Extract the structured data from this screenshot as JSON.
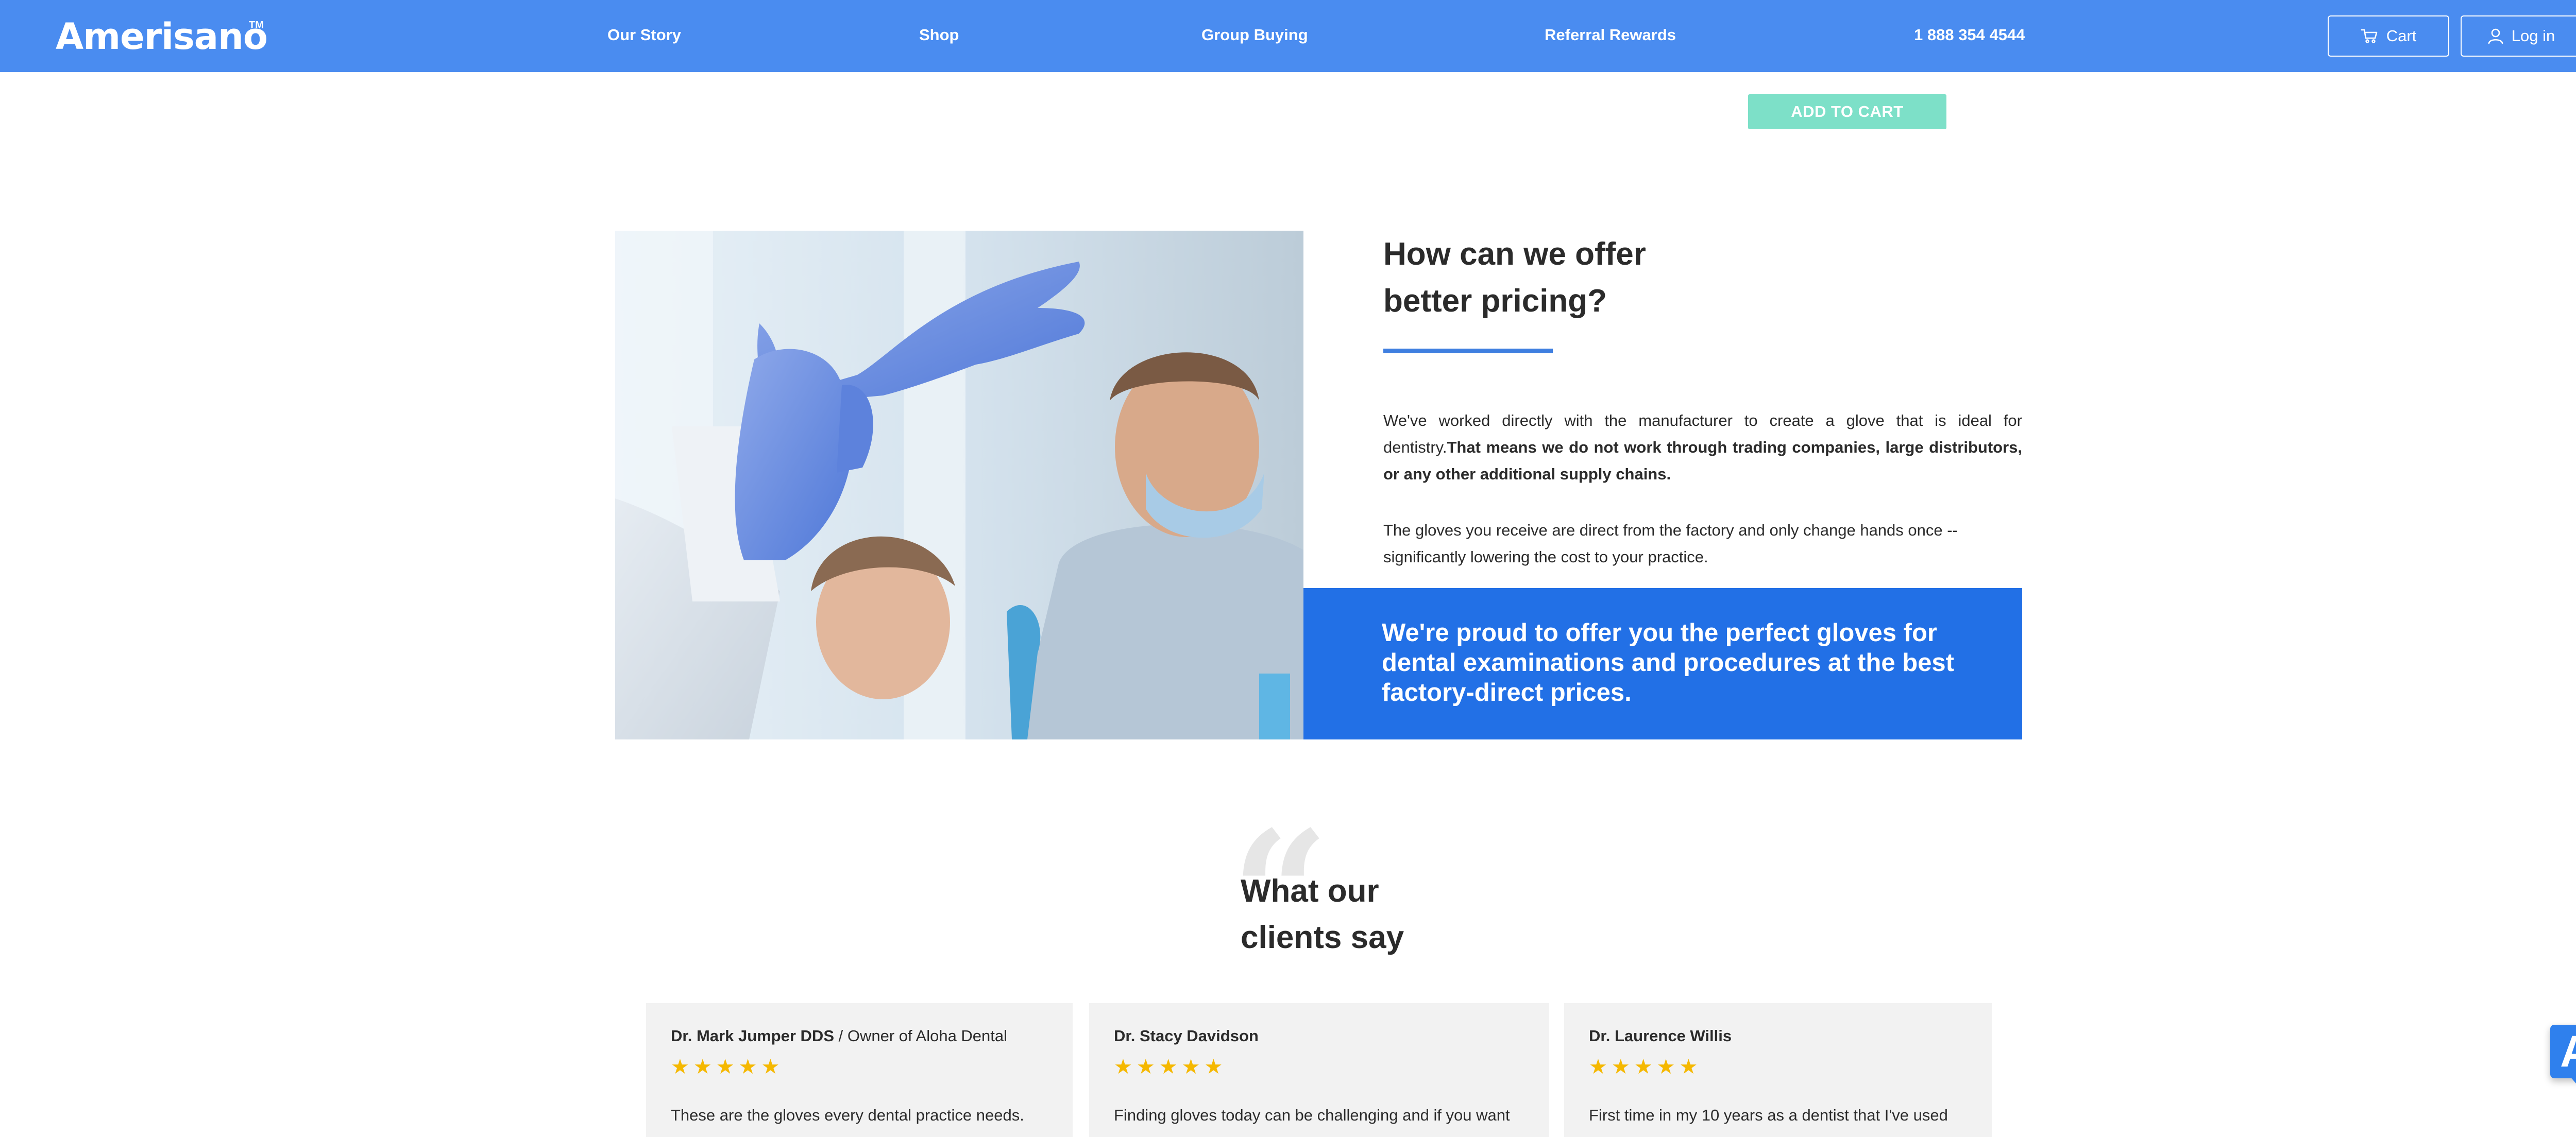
{
  "header": {
    "logo": "Amerisano",
    "logo_mark": "TM",
    "nav": [
      {
        "label": "Our Story"
      },
      {
        "label": "Shop"
      },
      {
        "label": "Group Buying"
      },
      {
        "label": "Referral Rewards"
      },
      {
        "label": "1 888 354 4544"
      }
    ],
    "cart_label": "Cart",
    "login_label": "Log in"
  },
  "product": {
    "add_to_cart_label": "ADD TO CART"
  },
  "pricing": {
    "heading_line1": "How can we offer",
    "heading_line2": "better pricing?",
    "para1_plain": "We've worked directly with the manufacturer to create a glove that is ideal for dentistry.",
    "para1_bold": "That means we do not work through trading companies, large distributors, or any other additional supply chains.",
    "para2": "The gloves you receive are direct from the factory and only change hands once -- significantly lowering the cost to your practice.",
    "banner": "We're proud to offer you the perfect gloves for dental examinations and procedures at the best factory-direct prices."
  },
  "testimonials": {
    "heading_line1": "What our",
    "heading_line2": "clients say",
    "quote_glyph": "“",
    "star_glyph": "★",
    "cards": [
      {
        "name": "Dr. Mark Jumper DDS",
        "separator": " / ",
        "role": "Owner of Aloha Dental",
        "rating": 5,
        "text": "These are the gloves every dental practice needs."
      },
      {
        "name": "Dr. Stacy Davidson",
        "separator": "",
        "role": "",
        "rating": 5,
        "text": "Finding gloves today can be challenging and if you want"
      },
      {
        "name": "Dr. Laurence Willis",
        "separator": "",
        "role": "",
        "rating": 5,
        "text": "First time in my 10 years as a dentist that I've used"
      }
    ]
  },
  "widget": {
    "label": "A"
  },
  "colors": {
    "header_bg": "#4a8cf0",
    "accent_blue": "#2270e6",
    "add_to_cart_bg": "#7de0c8",
    "star": "#f5b800",
    "card_bg": "#f2f2f2"
  }
}
